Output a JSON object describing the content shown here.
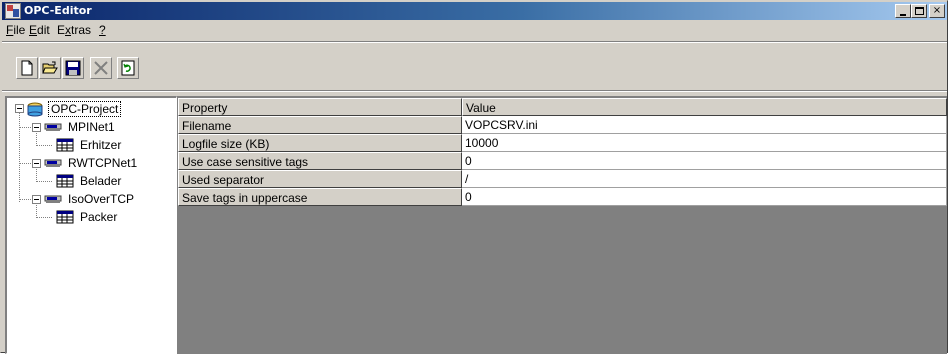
{
  "window": {
    "title": "OPC-Editor",
    "controls": {
      "minimize": "_",
      "maximize": "□",
      "close": "×"
    }
  },
  "menu": {
    "items": [
      {
        "u": "F",
        "rest": "ile"
      },
      {
        "u": "E",
        "rest": "dit"
      },
      {
        "pre": "E",
        "u": "x",
        "rest": "tras"
      },
      {
        "u": "?",
        "rest": ""
      }
    ]
  },
  "toolbar": {
    "buttons": [
      "new-icon",
      "open-folder-icon",
      "save-icon",
      "delete-icon",
      "refresh-icon"
    ]
  },
  "tree": {
    "root": "OPC-Project",
    "nodes": [
      {
        "label": "MPINet1",
        "child": "Erhitzer"
      },
      {
        "label": "RWTCPNet1",
        "child": "Belader"
      },
      {
        "label": "IsoOverTCP",
        "child": "Packer"
      }
    ]
  },
  "grid": {
    "headers": [
      "Property",
      "Value"
    ],
    "rows": [
      {
        "property": "Filename",
        "value": "VOPCSRV.ini"
      },
      {
        "property": "Logfile size (KB)",
        "value": "10000"
      },
      {
        "property": "Use case sensitive tags",
        "value": "0"
      },
      {
        "property": "Used separator",
        "value": "/"
      },
      {
        "property": "Save tags in uppercase",
        "value": "0"
      }
    ]
  },
  "colors": {
    "titlebar_start": "#0a246a",
    "titlebar_end": "#a6caf0",
    "face": "#d4d0c8",
    "empty_grid": "#808080"
  }
}
